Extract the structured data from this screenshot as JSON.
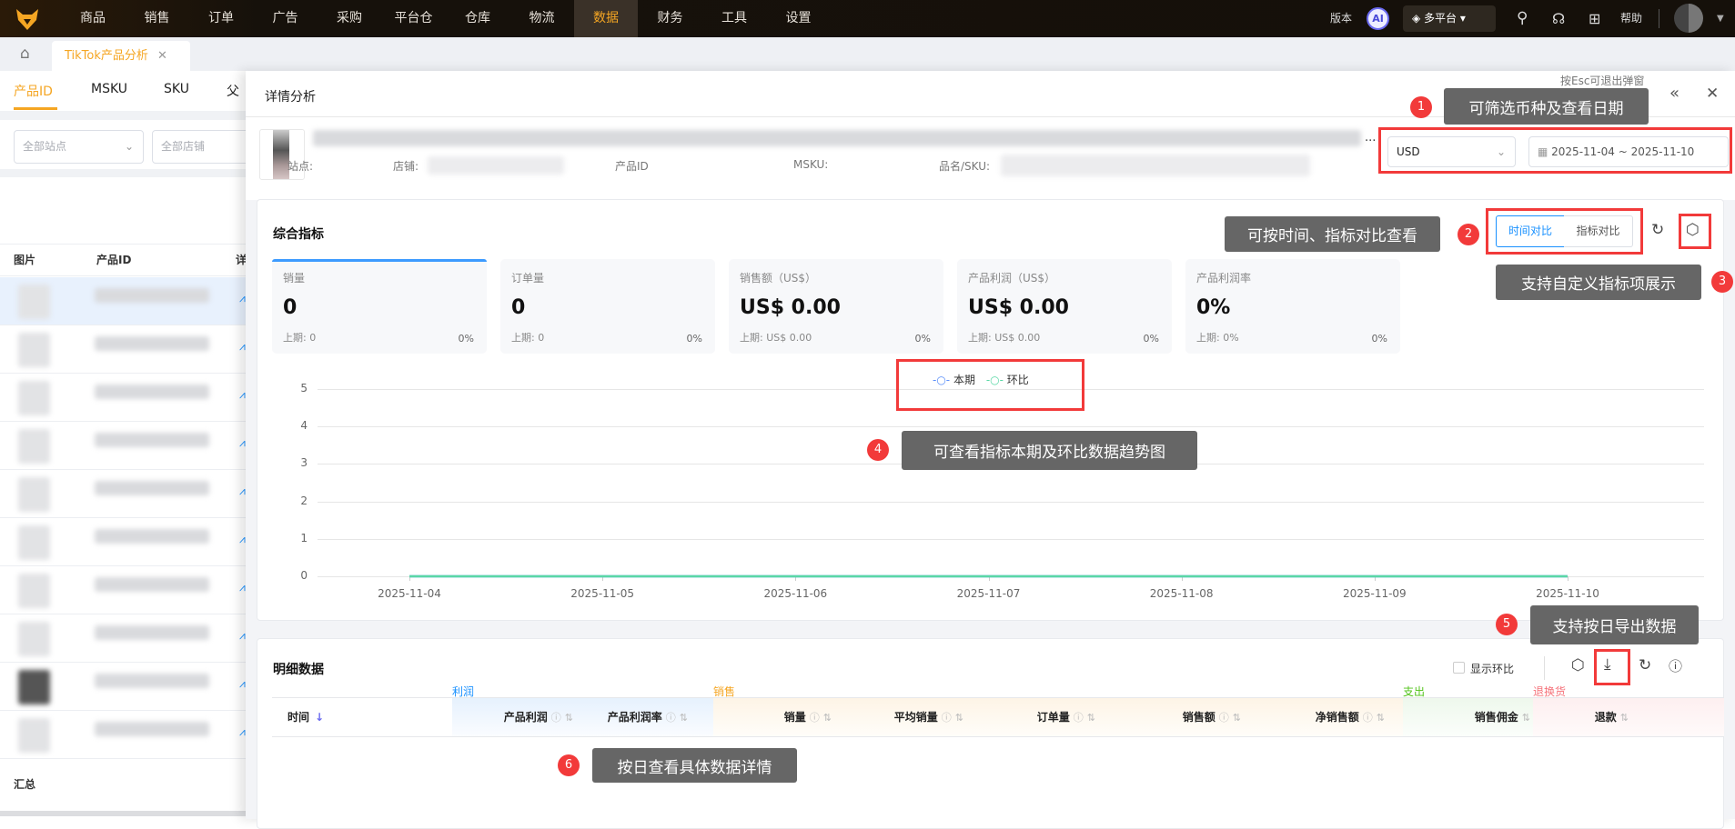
{
  "nav": {
    "items": [
      "商品",
      "销售",
      "订单",
      "广告",
      "采购",
      "平台仓",
      "仓库",
      "物流",
      "数据",
      "财务",
      "工具",
      "设置"
    ],
    "active": "数据",
    "version": "版本",
    "ai": "AI",
    "platform": "多平台",
    "help": "帮助"
  },
  "tabs": {
    "current": "TikTok产品分析"
  },
  "left": {
    "tabs": [
      "产品ID",
      "MSKU",
      "SKU",
      "父"
    ],
    "site_placeholder": "全部站点",
    "shop_placeholder": "全部店铺",
    "columns": [
      "图片",
      "产品ID",
      "详"
    ],
    "summary": "汇总"
  },
  "modal": {
    "title": "详情分析",
    "esc_hint": "按Esc可退出弹窗",
    "product": {
      "site_label": "站点:",
      "shop_label": "店铺:",
      "pid_label": "产品ID",
      "msku_label": "MSKU:",
      "name_label": "品名/SKU:",
      "ellipsis": "..."
    },
    "currency": "USD",
    "date_range": "2025-11-04 ~ 2025-11-10"
  },
  "overview": {
    "title": "综合指标",
    "compare_time": "时间对比",
    "compare_metric": "指标对比",
    "metrics": [
      {
        "label": "销量",
        "value": "0",
        "prev": "上期: 0",
        "pct": "0%"
      },
      {
        "label": "订单量",
        "value": "0",
        "prev": "上期: 0",
        "pct": "0%"
      },
      {
        "label": "销售额（US$）",
        "value": "US$ 0.00",
        "prev": "上期: US$ 0.00",
        "pct": "0%"
      },
      {
        "label": "产品利润（US$）",
        "value": "US$ 0.00",
        "prev": "上期: US$ 0.00",
        "pct": "0%"
      },
      {
        "label": "产品利润率",
        "value": "0%",
        "prev": "上期: 0%",
        "pct": "0%"
      }
    ]
  },
  "chart_data": {
    "type": "line",
    "x": [
      "2025-11-04",
      "2025-11-05",
      "2025-11-06",
      "2025-11-07",
      "2025-11-08",
      "2025-11-09",
      "2025-11-10"
    ],
    "series": [
      {
        "name": "本期",
        "color": "#5b8ff9",
        "values": [
          0,
          0,
          0,
          0,
          0,
          0,
          0
        ]
      },
      {
        "name": "环比",
        "color": "#5ad8a6",
        "values": [
          0,
          0,
          0,
          0,
          0,
          0,
          0
        ]
      }
    ],
    "yticks": [
      "0",
      "1",
      "2",
      "3",
      "4",
      "5"
    ],
    "ylim": [
      0,
      5
    ],
    "legend": "top-center",
    "grid": true
  },
  "detail": {
    "title": "明细数据",
    "show_compare": "显示环比",
    "groups": [
      {
        "label": "利润",
        "color": "#1890ff"
      },
      {
        "label": "销售",
        "color": "#f5a623"
      },
      {
        "label": "支出",
        "color": "#52c41a"
      },
      {
        "label": "退换货",
        "color": "#f5727a"
      }
    ],
    "columns": [
      "时间",
      "产品利润",
      "产品利润率",
      "销量",
      "平均销量",
      "订单量",
      "销售额",
      "净销售额",
      "销售佣金",
      "退款"
    ]
  },
  "annotations": [
    {
      "num": "1",
      "text": "可筛选币种及查看日期"
    },
    {
      "num": "2",
      "text": "可按时间、指标对比查看"
    },
    {
      "num": "3",
      "text": "支持自定义指标项展示"
    },
    {
      "num": "4",
      "text": "可查看指标本期及环比数据趋势图"
    },
    {
      "num": "5",
      "text": "支持按日导出数据"
    },
    {
      "num": "6",
      "text": "按日查看具体数据详情"
    }
  ]
}
